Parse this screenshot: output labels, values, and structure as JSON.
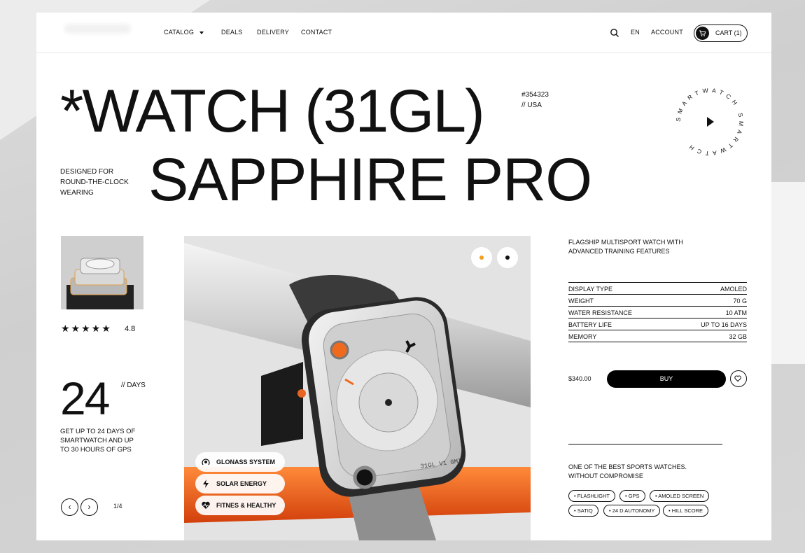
{
  "nav": {
    "links": [
      "CATALOG",
      "DEALS",
      "DELIVERY",
      "CONTACT"
    ],
    "lang": "EN",
    "account": "ACCOUNT",
    "cart": "CART (1)"
  },
  "hero": {
    "title_line1": "*WATCH (31GL)",
    "title_line2": "SAPPHIRE PRO",
    "sku": "#354323",
    "origin": "// USA",
    "designed_for": "DESIGNED FOR ROUND-THE-CLOCK WEARING",
    "badge_text": "SMARTWATCH SMARTWATCH"
  },
  "left": {
    "rating_stars": "★★★★★",
    "rating_value": "4.8",
    "big_number": "24",
    "days_label": "// DAYS",
    "days_desc": "GET UP TO 24 DAYS OF SMARTWATCH AND UP TO 30 HOURS OF GPS",
    "prev": "‹",
    "next": "›",
    "pager": "1/4"
  },
  "features": [
    "GLONASS SYSTEM",
    "SOLAR ENERGY",
    "FITNES & HEALTHY"
  ],
  "watch_label": "31GL V1 GMT",
  "right": {
    "tagline": "FLAGSHIP MULTISPORT WATCH WITH ADVANCED TRAINING FEATURES",
    "specs": [
      {
        "k": "DISPLAY TYPE",
        "v": "AMOLED"
      },
      {
        "k": "WEIGHT",
        "v": "70 G"
      },
      {
        "k": "WATER RESISTANCE",
        "v": "10 ATM"
      },
      {
        "k": "BATTERY LIFE",
        "v": "UP TO 16 DAYS"
      },
      {
        "k": "MEMORY",
        "v": "32 GB"
      }
    ],
    "price": "$340.00",
    "buy": "BUY",
    "best": "ONE OF THE BEST SPORTS WATCHES. WITHOUT COMPROMISE",
    "chips": [
      "• FLASHLIGHT",
      "• GPS",
      "• AMOLED SCREEN",
      "• SATIQ",
      "• 24 D AUTONOMY",
      "• HILL SCORE"
    ]
  },
  "colors": {
    "accent": "#f06a1d",
    "ink": "#111111"
  }
}
